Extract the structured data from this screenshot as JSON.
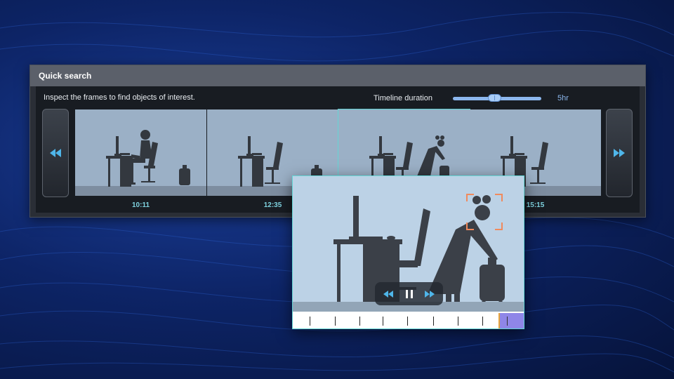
{
  "panel": {
    "title": "Quick search",
    "instructions": "Inspect the frames to find objects of interest.",
    "duration_label": "Timeline duration",
    "duration_value": "5hr",
    "duration_level": 0.5
  },
  "nav": {
    "prev_icon": "rewind-icon",
    "next_icon": "fast-forward-icon"
  },
  "frames": [
    {
      "time": "10:11"
    },
    {
      "time": "12:35"
    },
    {
      "time": ""
    },
    {
      "time": "15:15"
    }
  ],
  "preview": {
    "controls": [
      "rewind-icon",
      "pause-icon",
      "fast-forward-icon"
    ],
    "focus_icon": "focus-frame-icon"
  },
  "colors": {
    "accent": "#63d5d5",
    "timestamp": "#7fd3e0",
    "slider": "#8cb7ee",
    "nav_arrow": "#4fb6ea",
    "focus": "#f08a5d",
    "marker": "#e8a53a",
    "buffer": "#8f86e8"
  }
}
